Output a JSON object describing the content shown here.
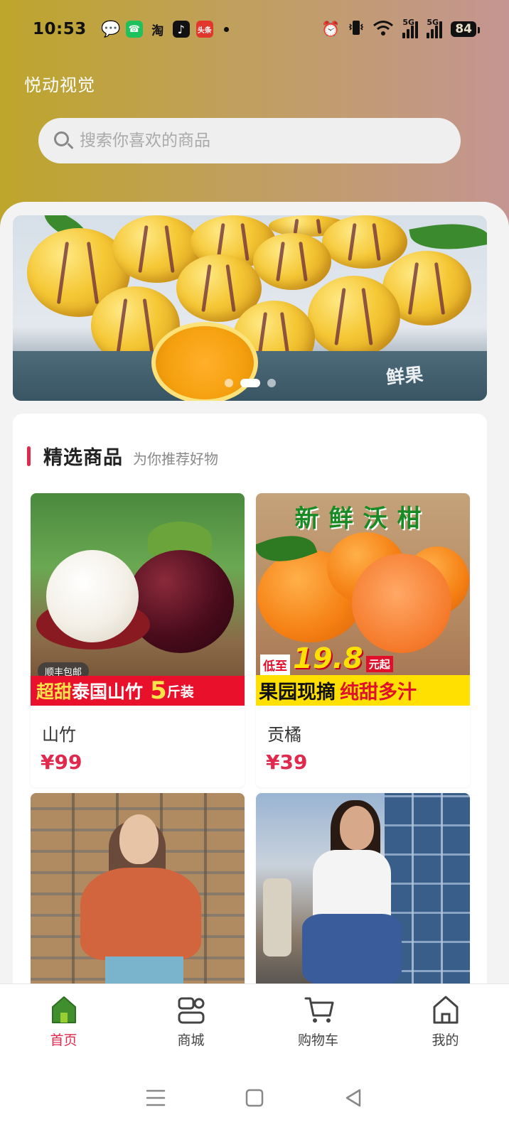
{
  "status_bar": {
    "time": "10:53",
    "battery": "84",
    "network_tags": [
      "5G",
      "5G"
    ],
    "notification_icons": [
      "wechat-icon",
      "phone-icon",
      "taobao-icon",
      "tiktok-icon",
      "toutiao-icon"
    ],
    "toutiao_label": "头条"
  },
  "app": {
    "title": "悦动视觉"
  },
  "search": {
    "placeholder": "搜索你喜欢的商品",
    "value": ""
  },
  "banner": {
    "box_text": "鲜果",
    "slides_count": 3,
    "active_slide": 2
  },
  "section": {
    "title": "精选商品",
    "subtitle": "为你推荐好物"
  },
  "products": [
    {
      "name": "山竹",
      "price": "¥99",
      "image_badge": "顺丰包邮",
      "image_caption_a": "超甜",
      "image_caption_b": "泰国山竹",
      "image_caption_c": "5",
      "image_caption_d": "斤装"
    },
    {
      "name": "贡橘",
      "price": "¥39",
      "image_title": "新鲜沃柑",
      "image_price_prefix": "低至",
      "image_price": "19.8",
      "image_price_unit": "元起",
      "image_caption_a": "果园现摘",
      "image_caption_b": "纯甜多汁"
    },
    {
      "name": "",
      "price": ""
    },
    {
      "name": "",
      "price": ""
    }
  ],
  "tabbar": {
    "items": [
      {
        "label": "首页",
        "icon": "home-filled-icon",
        "active": true
      },
      {
        "label": "商城",
        "icon": "mall-icon",
        "active": false
      },
      {
        "label": "购物车",
        "icon": "cart-icon",
        "active": false
      },
      {
        "label": "我的",
        "icon": "profile-home-icon",
        "active": false
      }
    ]
  },
  "colors": {
    "accent": "#e0294c",
    "active_tab_icon": "#3f8f2e",
    "header_gradient_start": "#bea52b",
    "header_gradient_end": "#c49592"
  }
}
